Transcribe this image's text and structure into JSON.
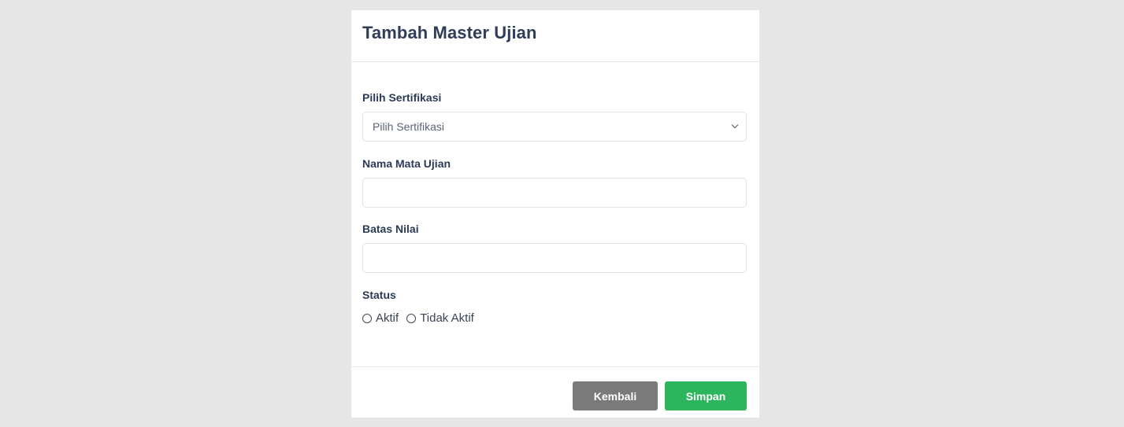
{
  "modal": {
    "title": "Tambah Master Ujian"
  },
  "form": {
    "sertifikasi": {
      "label": "Pilih Sertifikasi",
      "selected": "Pilih Sertifikasi"
    },
    "nama_mata_ujian": {
      "label": "Nama Mata Ujian",
      "value": "",
      "placeholder": ""
    },
    "batas_nilai": {
      "label": "Batas Nilai",
      "value": "",
      "placeholder": ""
    },
    "status": {
      "label": "Status",
      "options": [
        "Aktif",
        "Tidak Aktif"
      ],
      "selected": null
    }
  },
  "footer": {
    "back_label": "Kembali",
    "save_label": "Simpan"
  },
  "colors": {
    "background": "#e6e6e6",
    "back_button": "#7a7a7a",
    "save_button": "#2db55d",
    "title_text": "#2f3d58"
  },
  "icons": {
    "select_chevron": "chevron-down-icon",
    "radio": "radio-unchecked-icon"
  }
}
